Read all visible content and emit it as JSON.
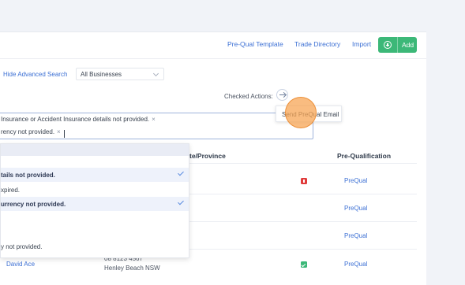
{
  "toolbar": {
    "prequal_template": "Pre-Qual Template",
    "trade_directory": "Trade Directory",
    "import": "Import",
    "add": "Add"
  },
  "search": {
    "advanced_link": "Hide Advanced Search",
    "business_select": "All Businesses",
    "checked_actions_label": "Checked Actions:",
    "popup_item": "Send PreQual Email"
  },
  "filter_tags": [
    {
      "text": "Insurance or Accident Insurance details not provided."
    },
    {
      "text": "rency not provided."
    }
  ],
  "dropdown": {
    "items": [
      {
        "text": "tails not provided.",
        "selected": true
      },
      {
        "text": "xpired.",
        "selected": false
      },
      {
        "text": "urrency not provided.",
        "selected": true
      },
      {
        "text": "",
        "selected": false
      },
      {
        "text": "",
        "selected": false
      },
      {
        "text": "y not provided.",
        "selected": false
      }
    ]
  },
  "table": {
    "headers": {
      "state": "te/Province",
      "prequal": "Pre-Qualification"
    },
    "rows": [
      {
        "prequal": "PreQual",
        "badge": "red"
      },
      {
        "prequal": "PreQual",
        "badge": ""
      },
      {
        "prequal": "PreQual",
        "badge": ""
      },
      {
        "name": "David Ace",
        "phone": "08 8123 4567",
        "location": "Henley Beach  NSW",
        "prequal": "PreQual",
        "badge": "green"
      }
    ]
  },
  "colors": {
    "accent": "#3b6fd4",
    "add_button": "#3cb878",
    "badge_red": "#e03b3b",
    "badge_green": "#3cb878",
    "click_highlight": "#f7a656"
  }
}
